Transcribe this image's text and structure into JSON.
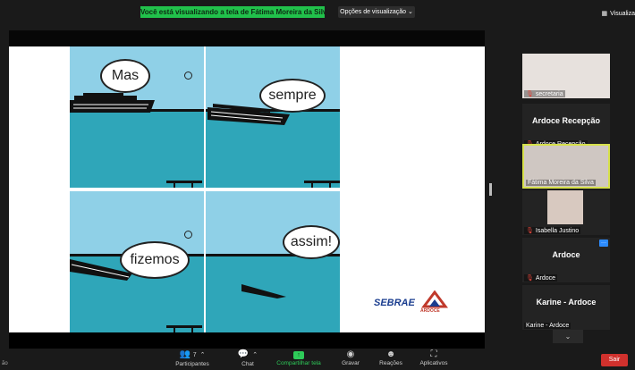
{
  "top": {
    "banner": "Você está visualizando a tela de Fátima Moreira da Silva",
    "view_options": "Opções de visualização",
    "view_label": "Visualiza"
  },
  "comic": {
    "bubbles": [
      "Mas",
      "sempre",
      "fizemos",
      "assim!"
    ]
  },
  "logos": {
    "sebrae": "SEBRAE",
    "ardoce": "ARDOCE"
  },
  "participants": [
    {
      "name": "secretaria",
      "muted": true
    },
    {
      "display": "Ardoce Recepção",
      "name": "Ardoce Recepção",
      "muted": true
    },
    {
      "name": "Fátima Moreira da Silva",
      "muted": false,
      "active_speaker": true
    },
    {
      "name": "Isabella Justino",
      "muted": true
    },
    {
      "display": "Ardoce",
      "name": "Ardoce",
      "muted": true
    },
    {
      "display": "Karine - Ardoce",
      "name": "Karine - Ardoce",
      "muted": false
    }
  ],
  "toolbar": {
    "participants_label": "Participantes",
    "participants_count": "7",
    "chat_label": "Chat",
    "share_label": "Compartilhar tela",
    "record_label": "Gravar",
    "reactions_label": "Reações",
    "apps_label": "Aplicativos",
    "leave_label": "Sair",
    "left_edge": "ão"
  },
  "colors": {
    "accent_green": "#21c14b",
    "leave_red": "#d0312d",
    "speaker_highlight": "#d6e04a",
    "sky": "#8fd0e7",
    "sea": "#2fa6b9"
  }
}
